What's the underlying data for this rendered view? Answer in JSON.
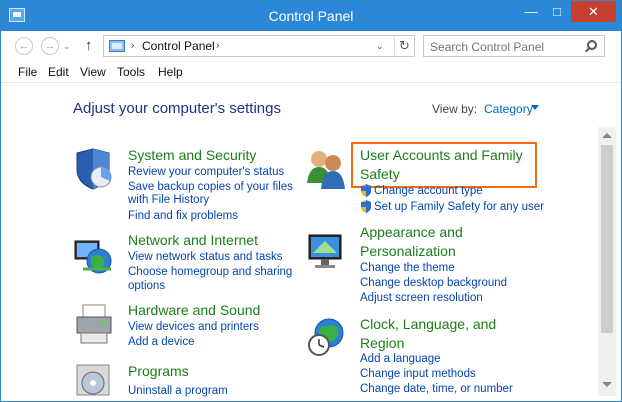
{
  "window": {
    "title": "Control Panel",
    "minimize": "—",
    "maximize": "□",
    "close": "✕"
  },
  "nav": {
    "back": "←",
    "forward": "→",
    "recent": "⌄",
    "up": "↑",
    "refresh": "↻"
  },
  "address": {
    "crumb": "Control Panel",
    "chevron": "›",
    "dropdown": "⌄"
  },
  "search": {
    "placeholder": "Search Control Panel"
  },
  "menu": [
    "File",
    "Edit",
    "View",
    "Tools",
    "Help"
  ],
  "page": {
    "heading": "Adjust your computer's settings",
    "view_by_label": "View by:",
    "view_by_value": "Category"
  },
  "categories": [
    {
      "title_lines": [
        "System and Security"
      ],
      "links": [
        "Review your computer's status",
        "Save backup copies of your files",
        "with File History",
        "Find and fix problems"
      ]
    },
    {
      "title_lines": [
        "Network and Internet"
      ],
      "links": [
        "View network status and tasks",
        "Choose homegroup and sharing",
        "options"
      ]
    },
    {
      "title_lines": [
        "Hardware and Sound"
      ],
      "links": [
        "View devices and printers",
        "Add a device"
      ]
    },
    {
      "title_lines": [
        "Programs"
      ],
      "links": [
        "Uninstall a program"
      ]
    },
    {
      "title_lines": [
        "User Accounts and Family",
        "Safety"
      ],
      "links": [
        "Change account type",
        "Set up Family Safety for any user"
      ]
    },
    {
      "title_lines": [
        "Appearance and",
        "Personalization"
      ],
      "links": [
        "Change the theme",
        "Change desktop background",
        "Adjust screen resolution"
      ]
    },
    {
      "title_lines": [
        "Clock, Language, and",
        "Region"
      ],
      "links": [
        "Add a language",
        "Change input methods",
        "Change date, time, or number"
      ]
    }
  ],
  "colors": {
    "titlebar": "#2b88d8",
    "category_title": "#1a7d1a",
    "link": "#0645ad",
    "heading": "#1e3287",
    "highlight": "#f46b16"
  }
}
